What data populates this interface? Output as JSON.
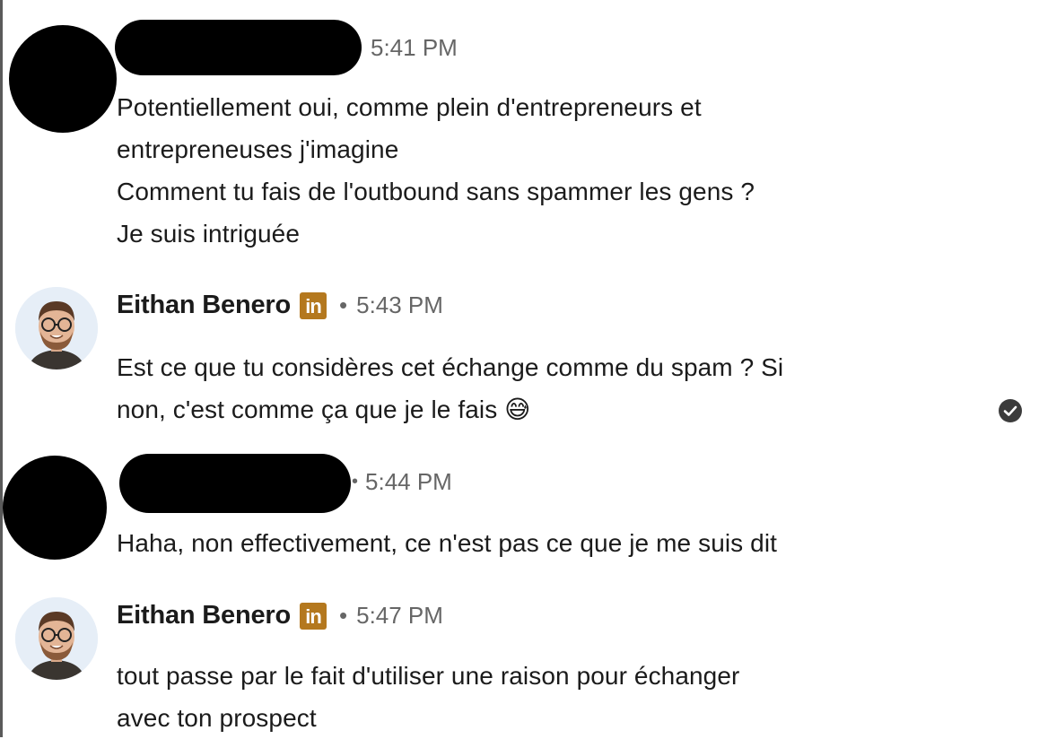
{
  "messages": [
    {
      "sender": "",
      "time": "5:41 PM",
      "lines": "Potentiellement oui, comme plein d'entrepreneurs et\nentrepreneuses j'imagine\nComment tu fais de l'outbound sans spammer les gens ?\nJe suis intriguée"
    },
    {
      "sender": "Eithan Benero",
      "badge": "in",
      "separator": "•",
      "time": "5:43 PM",
      "lines": "Est ce que tu considères cet échange comme du spam ? Si\nnon, c'est comme ça que je le fais 😅"
    },
    {
      "sender": "",
      "separator": "•",
      "time": "5:44 PM",
      "lines": "Haha, non effectivement, ce n'est pas ce que je me suis dit"
    },
    {
      "sender": "Eithan Benero",
      "badge": "in",
      "separator": "•",
      "time": "5:47 PM",
      "lines": "tout passe par le fait d'utiliser une raison pour échanger\navec ton prospect"
    }
  ],
  "colors": {
    "linkedin_badge": "#b4781e",
    "timestamp": "#666666",
    "text": "#1b1b1b"
  },
  "icons": {
    "read_receipt": "check-circle-icon",
    "premium_badge": "linkedin-icon"
  }
}
